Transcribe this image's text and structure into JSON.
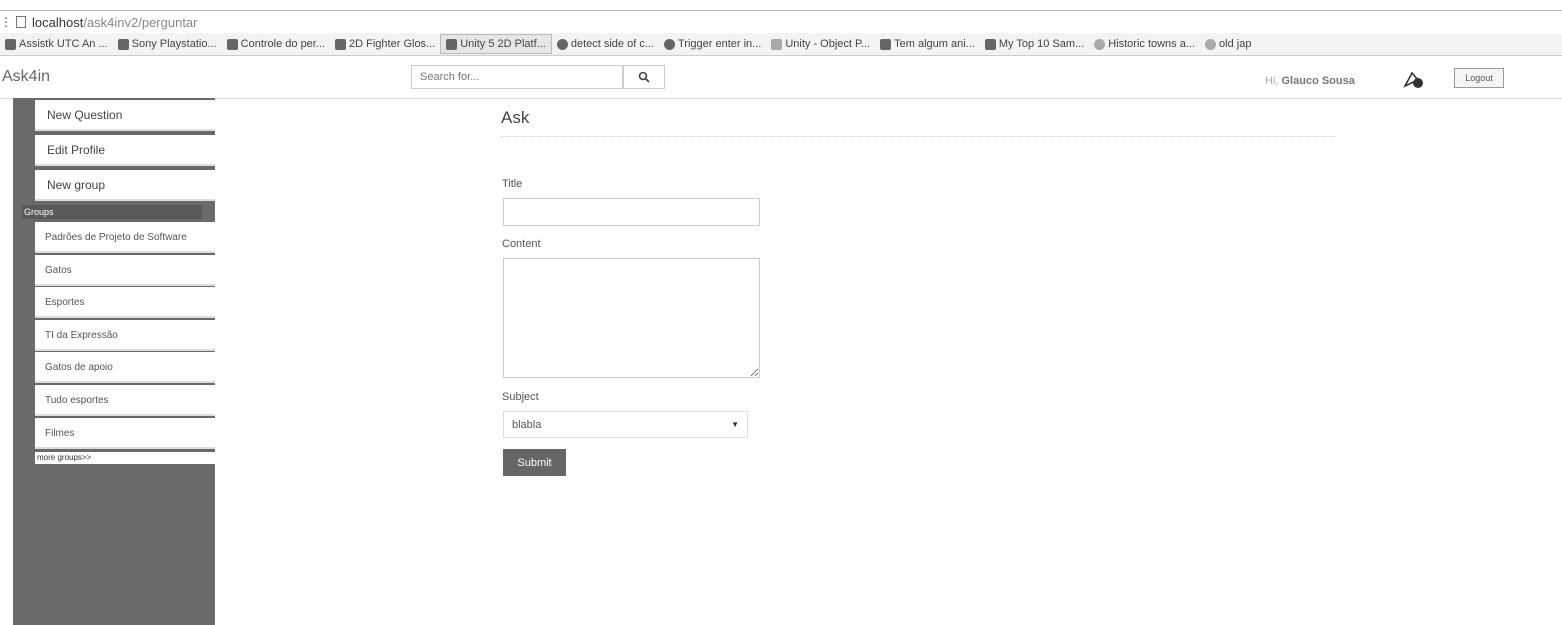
{
  "browser": {
    "url_host": "localhost",
    "url_path": "/ask4inv2/perguntar",
    "bookmarks": [
      {
        "label": "Assistk UTC An ...",
        "icon": "bookmark-icon"
      },
      {
        "label": "Sony Playstatio...",
        "icon": "playstation-icon"
      },
      {
        "label": "Controle do per...",
        "icon": "youtube-icon"
      },
      {
        "label": "2D Fighter Glos...",
        "icon": "youtube-icon"
      },
      {
        "label": "Unity 5 2D Platf...",
        "icon": "youtube-icon"
      },
      {
        "label": "detect side of c...",
        "icon": "unity-icon"
      },
      {
        "label": "Trigger enter in...",
        "icon": "unity-icon"
      },
      {
        "label": "Unity - Object P...",
        "icon": "page-icon"
      },
      {
        "label": "Tem algum ani...",
        "icon": "forum-icon"
      },
      {
        "label": "My Top 10 Sam...",
        "icon": "youtube-icon"
      },
      {
        "label": "Historic towns a...",
        "icon": "globe-icon"
      },
      {
        "label": "old jap",
        "icon": "google-icon"
      }
    ]
  },
  "navbar": {
    "brand": "Ask4in",
    "search_placeholder": "Search for...",
    "greeting_prefix": "Hi, ",
    "user_name": "Glauco Sousa",
    "logout_label": "Logout"
  },
  "sidebar": {
    "actions": [
      "New Question",
      "Edit Profile",
      "New group"
    ],
    "groups_header": "Groups",
    "groups": [
      "Padrões de Projeto de Software",
      "Gatos",
      "Esportes",
      "TI da Expressão",
      "Gatos de apoio",
      "Tudo esportes",
      "Filmes"
    ],
    "more_groups": "more groups>>"
  },
  "form": {
    "heading": "Ask",
    "title_label": "Title",
    "title_value": "",
    "content_label": "Content",
    "content_value": "",
    "subject_label": "Subject",
    "subject_selected": "blabla",
    "submit_label": "Submit"
  }
}
